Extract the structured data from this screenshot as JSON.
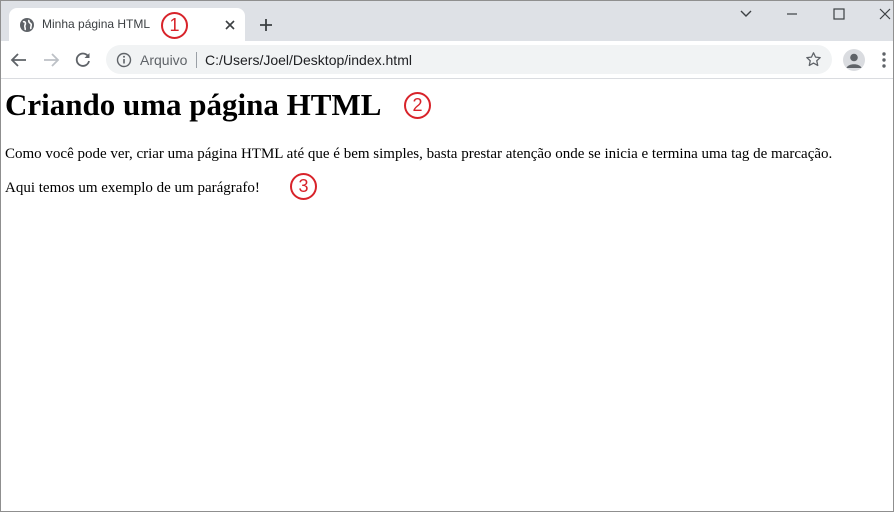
{
  "tab": {
    "title": "Minha página HTML",
    "favicon": "globe-icon"
  },
  "toolbar": {
    "security_label": "Arquivo",
    "url": "C:/Users/Joel/Desktop/index.html"
  },
  "page": {
    "heading": "Criando uma página HTML",
    "paragraphs": [
      "Como você pode ver, criar uma página HTML até que é bem simples, basta prestar atenção onde se inicia e termina uma tag de marcação.",
      "Aqui temos um exemplo de um parágrafo!"
    ]
  },
  "annotations": [
    "1",
    "2",
    "3"
  ],
  "colors": {
    "tabstrip": "#dee1e6",
    "omnibox": "#f1f3f4",
    "annotation": "#d8232a"
  }
}
